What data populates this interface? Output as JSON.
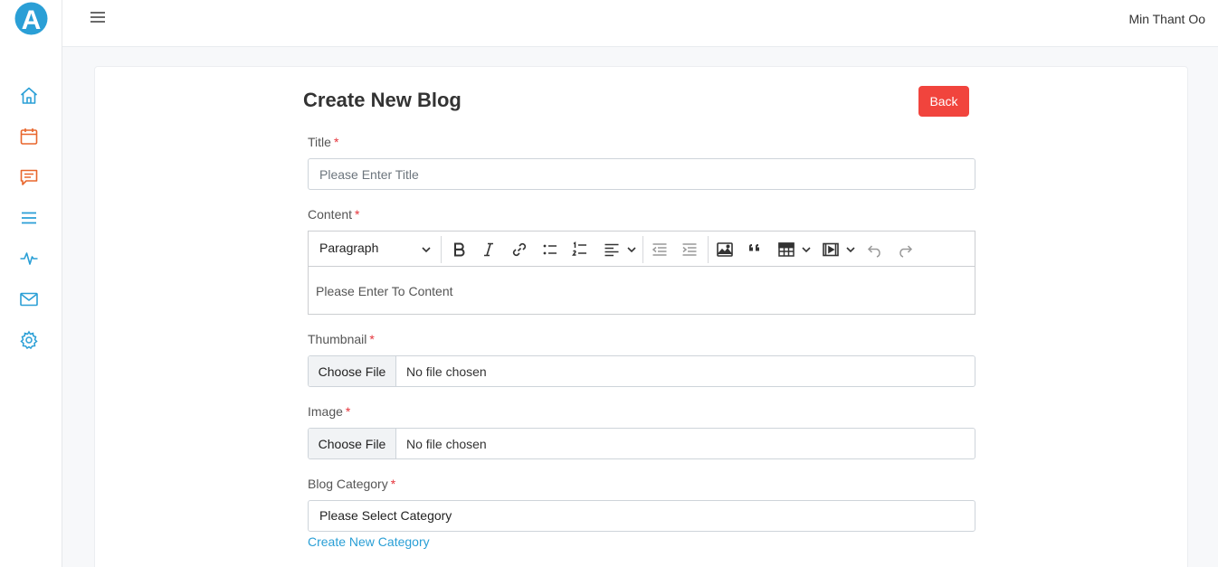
{
  "header": {
    "user_name": "Min Thant Oo"
  },
  "sidebar": {
    "logo_letter": "A",
    "items": [
      {
        "icon": "home-icon"
      },
      {
        "icon": "calendar-icon"
      },
      {
        "icon": "chat-icon"
      },
      {
        "icon": "list-icon"
      },
      {
        "icon": "activity-icon"
      },
      {
        "icon": "mail-icon"
      },
      {
        "icon": "gear-icon"
      }
    ]
  },
  "page": {
    "title": "Create New Blog",
    "back_label": "Back"
  },
  "form": {
    "title": {
      "label": "Title",
      "required_mark": "*",
      "placeholder": "Please Enter Title"
    },
    "content": {
      "label": "Content",
      "required_mark": "*",
      "paragraph_label": "Paragraph",
      "placeholder": "Please Enter To Content"
    },
    "thumbnail": {
      "label": "Thumbnail",
      "required_mark": "*",
      "button": "Choose File",
      "status": "No file chosen"
    },
    "image": {
      "label": "Image",
      "required_mark": "*",
      "button": "Choose File",
      "status": "No file chosen"
    },
    "category": {
      "label": "Blog Category",
      "required_mark": "*",
      "value": "Please Select Category",
      "create_link": "Create New Category"
    }
  },
  "colors": {
    "accent": "#2a9fd6",
    "danger": "#f1443d",
    "orange": "#e8662c"
  }
}
